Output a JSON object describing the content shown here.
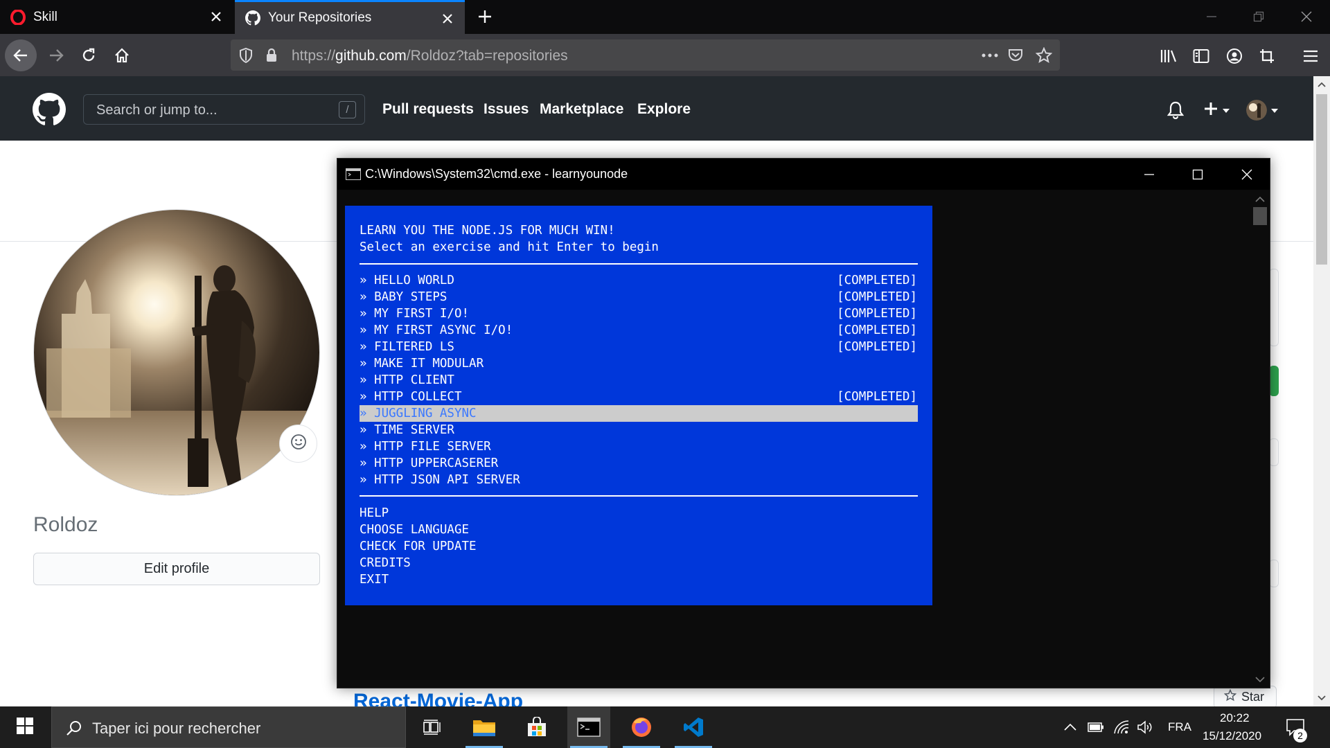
{
  "browser": {
    "tabs": [
      {
        "title": "Skill",
        "icon": "opera-icon"
      },
      {
        "title": "Your Repositories",
        "icon": "github-icon",
        "active": true
      }
    ],
    "url": {
      "scheme": "https://",
      "host": "github.com",
      "path": "/Roldoz?tab=repositories"
    }
  },
  "github": {
    "search_placeholder": "Search or jump to...",
    "search_shortcut": "/",
    "nav": [
      "Pull requests",
      "Issues",
      "Marketplace",
      "Explore"
    ],
    "profile": {
      "username": "Roldoz",
      "edit_button": "Edit profile"
    },
    "repo_name": "React-Movie-App",
    "star_label": "Star"
  },
  "cmd": {
    "title": "C:\\Windows\\System32\\cmd.exe - learnyounode",
    "header": [
      "LEARN YOU THE NODE.JS FOR MUCH WIN!",
      "Select an exercise and hit Enter to begin"
    ],
    "exercises": [
      {
        "label": "» HELLO WORLD",
        "status": "[COMPLETED]"
      },
      {
        "label": "» BABY STEPS",
        "status": "[COMPLETED]"
      },
      {
        "label": "» MY FIRST I/O!",
        "status": "[COMPLETED]"
      },
      {
        "label": "» MY FIRST ASYNC I/O!",
        "status": "[COMPLETED]"
      },
      {
        "label": "» FILTERED LS",
        "status": "[COMPLETED]"
      },
      {
        "label": "» MAKE IT MODULAR",
        "status": ""
      },
      {
        "label": "» HTTP CLIENT",
        "status": ""
      },
      {
        "label": "» HTTP COLLECT",
        "status": "[COMPLETED]"
      },
      {
        "label": "» JUGGLING ASYNC",
        "status": "",
        "selected": true
      },
      {
        "label": "» TIME SERVER",
        "status": ""
      },
      {
        "label": "» HTTP FILE SERVER",
        "status": ""
      },
      {
        "label": "» HTTP UPPERCASERER",
        "status": ""
      },
      {
        "label": "» HTTP JSON API SERVER",
        "status": ""
      }
    ],
    "menu": [
      "HELP",
      "CHOOSE LANGUAGE",
      "CHECK FOR UPDATE",
      "CREDITS",
      "EXIT"
    ]
  },
  "taskbar": {
    "search_placeholder": "Taper ici pour rechercher",
    "language": "FRA",
    "time": "20:22",
    "date": "15/12/2020",
    "notification_count": "2"
  },
  "colors": {
    "tui_background": "#0037da",
    "selection_background": "#cccccc",
    "selection_text": "#3b78ff",
    "github_header": "#24292e",
    "link_blue": "#0366d6",
    "firefox_accent": "#0a84ff"
  }
}
